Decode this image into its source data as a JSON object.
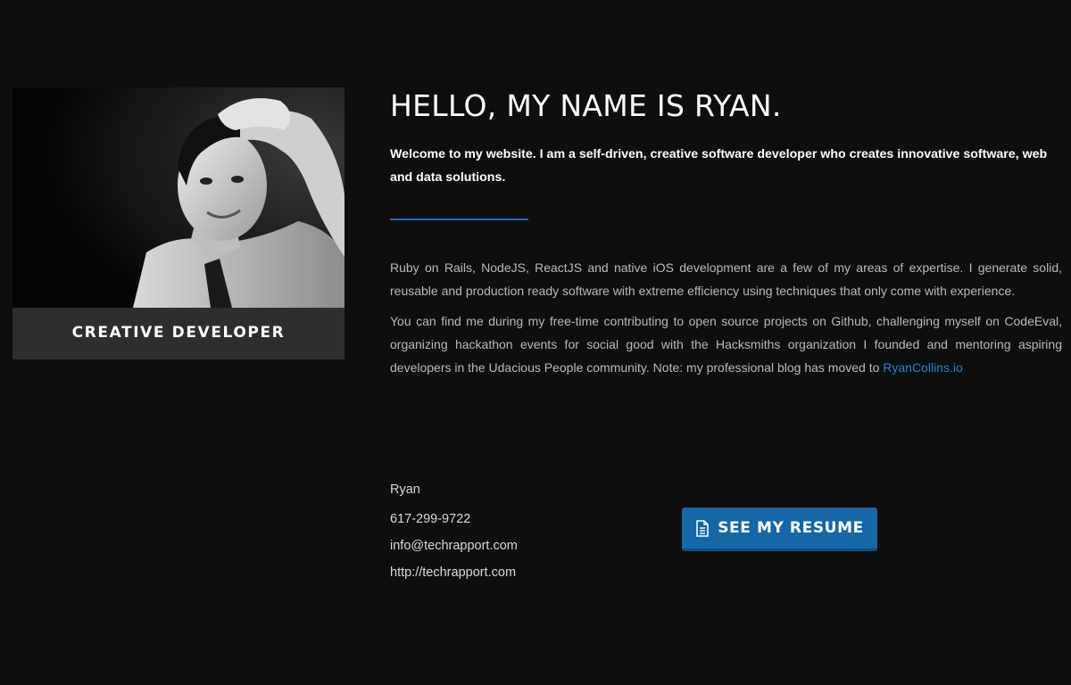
{
  "profile": {
    "caption": "CREATIVE DEVELOPER"
  },
  "main": {
    "title": "HELLO, MY NAME IS RYAN.",
    "intro": "Welcome to my website. I am a self-driven, creative software developer who creates innovative software, web and data solutions.",
    "paragraph1": "Ruby on Rails, NodeJS, ReactJS and native iOS development are a few of my areas of expertise. I generate solid, reusable and production ready software with extreme efficiency using techniques that only come with experience.",
    "paragraph2_text": "You can find me during my free-time contributing to open source projects on Github, challenging myself on CodeEval, organizing hackathon events for social good with the Hacksmiths organization I founded and mentoring aspiring developers in the Udacious People community. Note: my professional blog has moved to ",
    "blog_link_label": "RyanCollins.io"
  },
  "contact": {
    "name": "Ryan",
    "phone": "617-299-9722",
    "email": "info@techrapport.com",
    "website": "http://techrapport.com"
  },
  "resume_button": {
    "label": "SEE MY RESUME",
    "icon": "document-icon"
  },
  "colors": {
    "background": "#0e0e0f",
    "accent": "#1567a6",
    "link": "#1f86d4",
    "card": "#2e2e2f"
  }
}
